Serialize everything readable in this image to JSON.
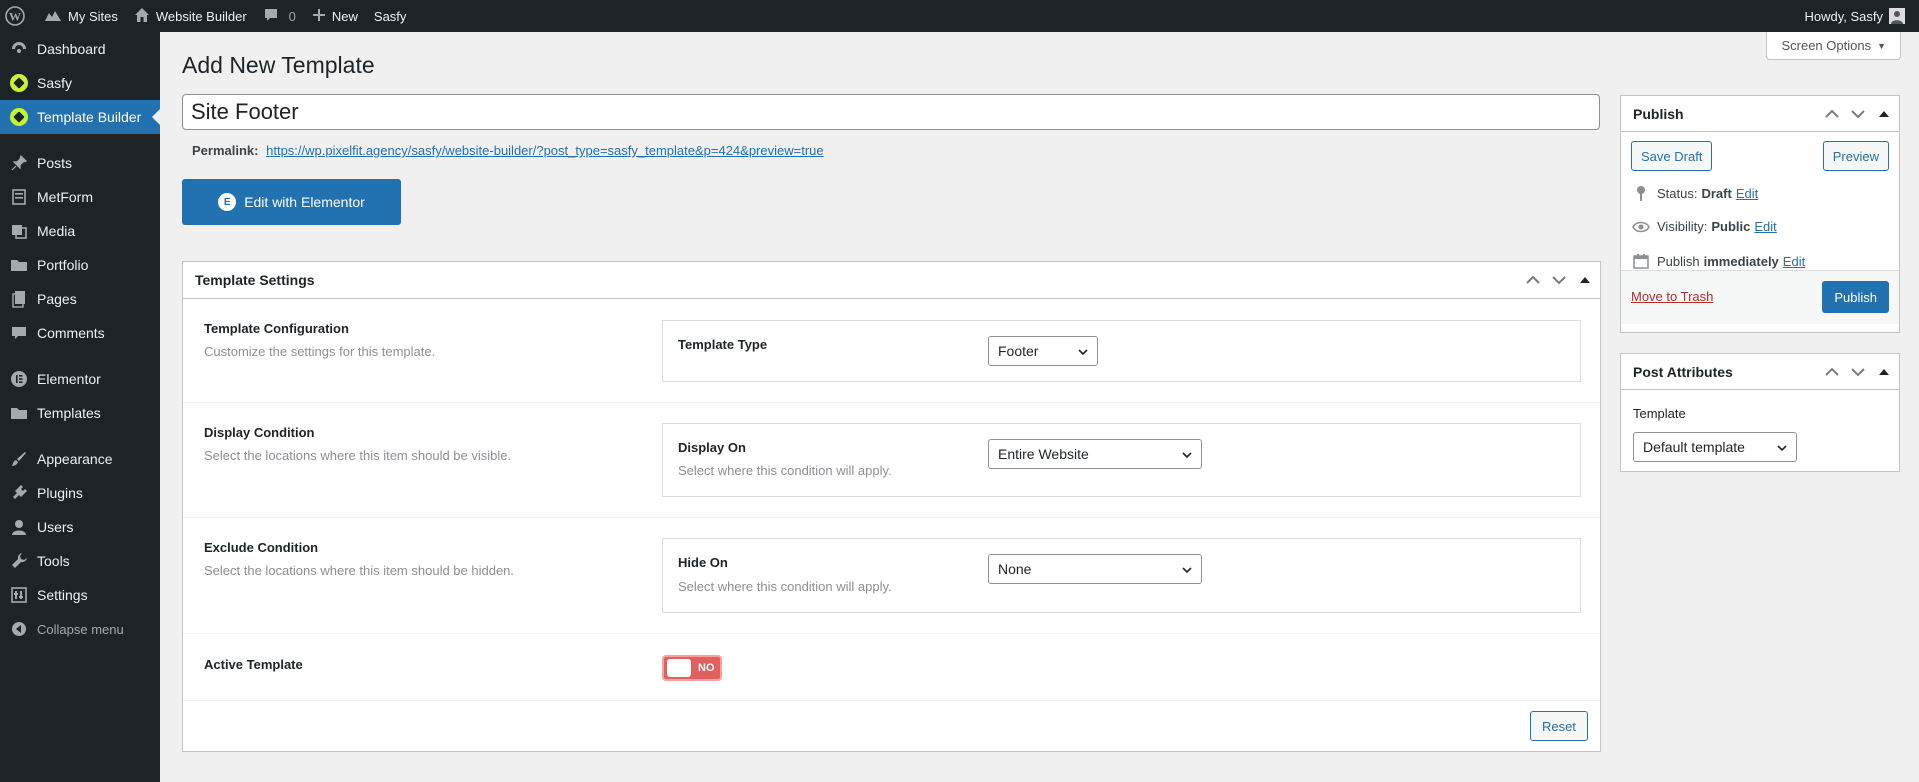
{
  "adminbar": {
    "my_sites": "My Sites",
    "site_name": "Website Builder",
    "comments_count": "0",
    "new_label": "New",
    "sasfy_label": "Sasfy",
    "howdy": "Howdy, Sasfy"
  },
  "sidebar": {
    "items": [
      {
        "label": "Dashboard",
        "icon": "dashboard-icon"
      },
      {
        "label": "Sasfy",
        "icon": "sasfy-icon"
      },
      {
        "label": "Template Builder",
        "icon": "sasfy-icon",
        "current": true
      },
      {
        "label": "Posts",
        "icon": "pin-icon"
      },
      {
        "label": "MetForm",
        "icon": "form-icon"
      },
      {
        "label": "Media",
        "icon": "media-icon"
      },
      {
        "label": "Portfolio",
        "icon": "folder-icon"
      },
      {
        "label": "Pages",
        "icon": "page-icon"
      },
      {
        "label": "Comments",
        "icon": "comment-icon"
      },
      {
        "label": "Elementor",
        "icon": "elementor-icon"
      },
      {
        "label": "Templates",
        "icon": "folder-icon"
      },
      {
        "label": "Appearance",
        "icon": "brush-icon"
      },
      {
        "label": "Plugins",
        "icon": "plugin-icon"
      },
      {
        "label": "Users",
        "icon": "user-icon"
      },
      {
        "label": "Tools",
        "icon": "wrench-icon"
      },
      {
        "label": "Settings",
        "icon": "settings-icon"
      }
    ],
    "collapse_label": "Collapse menu"
  },
  "screen_options": "Screen Options",
  "page": {
    "title": "Add New Template",
    "post_title": "Site Footer",
    "permalink_label": "Permalink:",
    "permalink_url": "https://wp.pixelfit.agency/sasfy/website-builder/?post_type=sasfy_template&p=424&preview=true",
    "elementor_button": "Edit with Elementor"
  },
  "template_settings": {
    "header": "Template Settings",
    "rows": {
      "config": {
        "label": "Template Configuration",
        "desc": "Customize the settings for this template.",
        "field_label": "Template Type",
        "value": "Footer"
      },
      "display": {
        "label": "Display Condition",
        "desc": "Select the locations where this item should be visible.",
        "field_label": "Display On",
        "field_desc": "Select where this condition will apply.",
        "value": "Entire Website"
      },
      "exclude": {
        "label": "Exclude Condition",
        "desc": "Select the locations where this item should be hidden.",
        "field_label": "Hide On",
        "field_desc": "Select where this condition will apply.",
        "value": "None"
      },
      "active": {
        "label": "Active Template",
        "toggle_label": "NO",
        "toggle_on": false
      }
    },
    "reset_label": "Reset"
  },
  "publish_box": {
    "header": "Publish",
    "save_draft": "Save Draft",
    "preview": "Preview",
    "status_label": "Status:",
    "status_value": "Draft",
    "visibility_label": "Visibility:",
    "visibility_value": "Public",
    "publish_label": "Publish",
    "publish_value": "immediately",
    "edit_label": "Edit",
    "trash": "Move to Trash",
    "publish_button": "Publish"
  },
  "post_attributes": {
    "header": "Post Attributes",
    "template_label": "Template",
    "template_value": "Default template"
  },
  "colors": {
    "admin_dark": "#1d2327",
    "accent_blue": "#2271b1",
    "toggle_off": "#e2605e",
    "trash_red": "#b32d2e",
    "brand_green": "#c6f432"
  }
}
